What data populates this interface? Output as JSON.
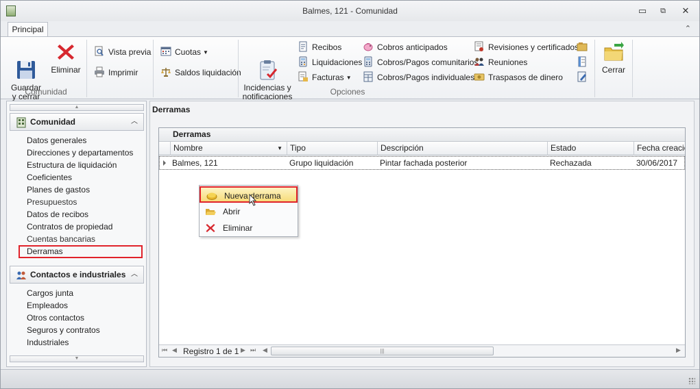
{
  "window": {
    "title": "Balmes, 121 - Comunidad",
    "controls": {
      "minimize": "▭",
      "restore": "⧉",
      "close": "✕"
    }
  },
  "ribbon": {
    "tab": "Principal",
    "collapse_glyph": "⌃",
    "groups": {
      "comunidad": "Comunidad",
      "opciones": "Opciones"
    },
    "buttons": {
      "guardar": "Guardar\ny cerrar",
      "eliminar": "Eliminar",
      "vista_previa": "Vista previa",
      "imprimir": "Imprimir",
      "cuotas": "Cuotas",
      "saldos": "Saldos liquidación",
      "incidencias": "Incidencias y\nnotificaciones",
      "recibos": "Recibos",
      "liquidaciones": "Liquidaciones",
      "facturas": "Facturas",
      "cobros_anticipados": "Cobros anticipados",
      "cobros_comunitarios": "Cobros/Pagos comunitarios",
      "cobros_individuales": "Cobros/Pagos individuales",
      "revisiones": "Revisiones y certificados",
      "reuniones": "Reuniones",
      "traspasos": "Traspasos de dinero",
      "cerrar": "Cerrar"
    }
  },
  "sidebar": {
    "sections": [
      {
        "title": "Comunidad",
        "items": [
          "Datos generales",
          "Direcciones y departamentos",
          "Estructura de liquidación",
          "Coeficientes",
          "Planes de gastos",
          "Presupuestos",
          "Datos de recibos",
          "Contratos de propiedad",
          "Cuentas bancarias",
          "Derramas"
        ]
      },
      {
        "title": "Contactos e industriales",
        "items": [
          "Cargos junta",
          "Empleados",
          "Otros contactos",
          "Seguros y contratos",
          "Industriales"
        ]
      }
    ],
    "selected": "Derramas"
  },
  "main": {
    "title": "Derramas",
    "grid": {
      "group_title": "Derramas",
      "columns": [
        "Nombre",
        "Tipo",
        "Descripción",
        "Estado",
        "Fecha creación"
      ],
      "rows": [
        [
          "Balmes, 121",
          "Grupo liquidación",
          "Pintar fachada posterior",
          "Rechazada",
          "30/06/2017"
        ]
      ],
      "nav_text": "Registro 1 de 1"
    }
  },
  "context_menu": {
    "items": [
      "Nueva derrama",
      "Abrir",
      "Eliminar"
    ],
    "highlighted": "Nueva derrama"
  },
  "colors": {
    "highlight_border": "#e0222a",
    "menu_hover": "#f7dc7a",
    "delete_red": "#d7282f"
  }
}
